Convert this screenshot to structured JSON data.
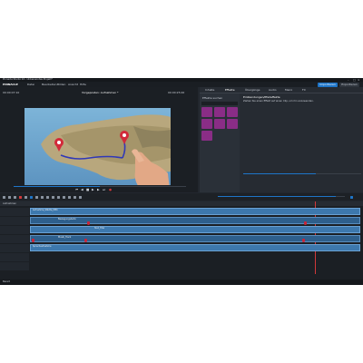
{
  "window": {
    "title": "Pinnacle Studio 24 - Unbenanntes Projekt*"
  },
  "menu": {
    "items": [
      "Datei",
      "Bearbeiten",
      "Bilden",
      "Ansicht",
      "Hilfe"
    ],
    "right_btn_1": "Importieren",
    "right_btn_2": "Exportieren"
  },
  "preview": {
    "timecode_left": "00:00:07:10",
    "title": "Vorgeposten: Aufnahmen *",
    "timecode_right": "00:00:25:00",
    "progress_fraction": 0.5
  },
  "panel": {
    "tabs": [
      "Inhalte",
      "Effekte",
      "Übergänge",
      "Audio",
      "Menü",
      "FX"
    ],
    "breadcrumb": "Einblendungen/Pfadeffekte",
    "info": "Ziehen Sie einen Effekt auf einen Clip, um ihn anzuwenden.",
    "section_label": "Effekte suchen"
  },
  "timeline": {
    "project_label": "Aufnahmen",
    "clip_labels": [
      "Aufnahme_Städte_MP4",
      "Bewegungsbahn",
      "Text_Titel",
      "Musik_Track",
      "Sprachaufnahme"
    ],
    "status": "Bereit"
  },
  "colors": {
    "accent": "#1e75c8",
    "effect_tile": "#8a2d86",
    "clip": "#3d78ad",
    "marker": "#c9253a",
    "background": "#22272e"
  }
}
